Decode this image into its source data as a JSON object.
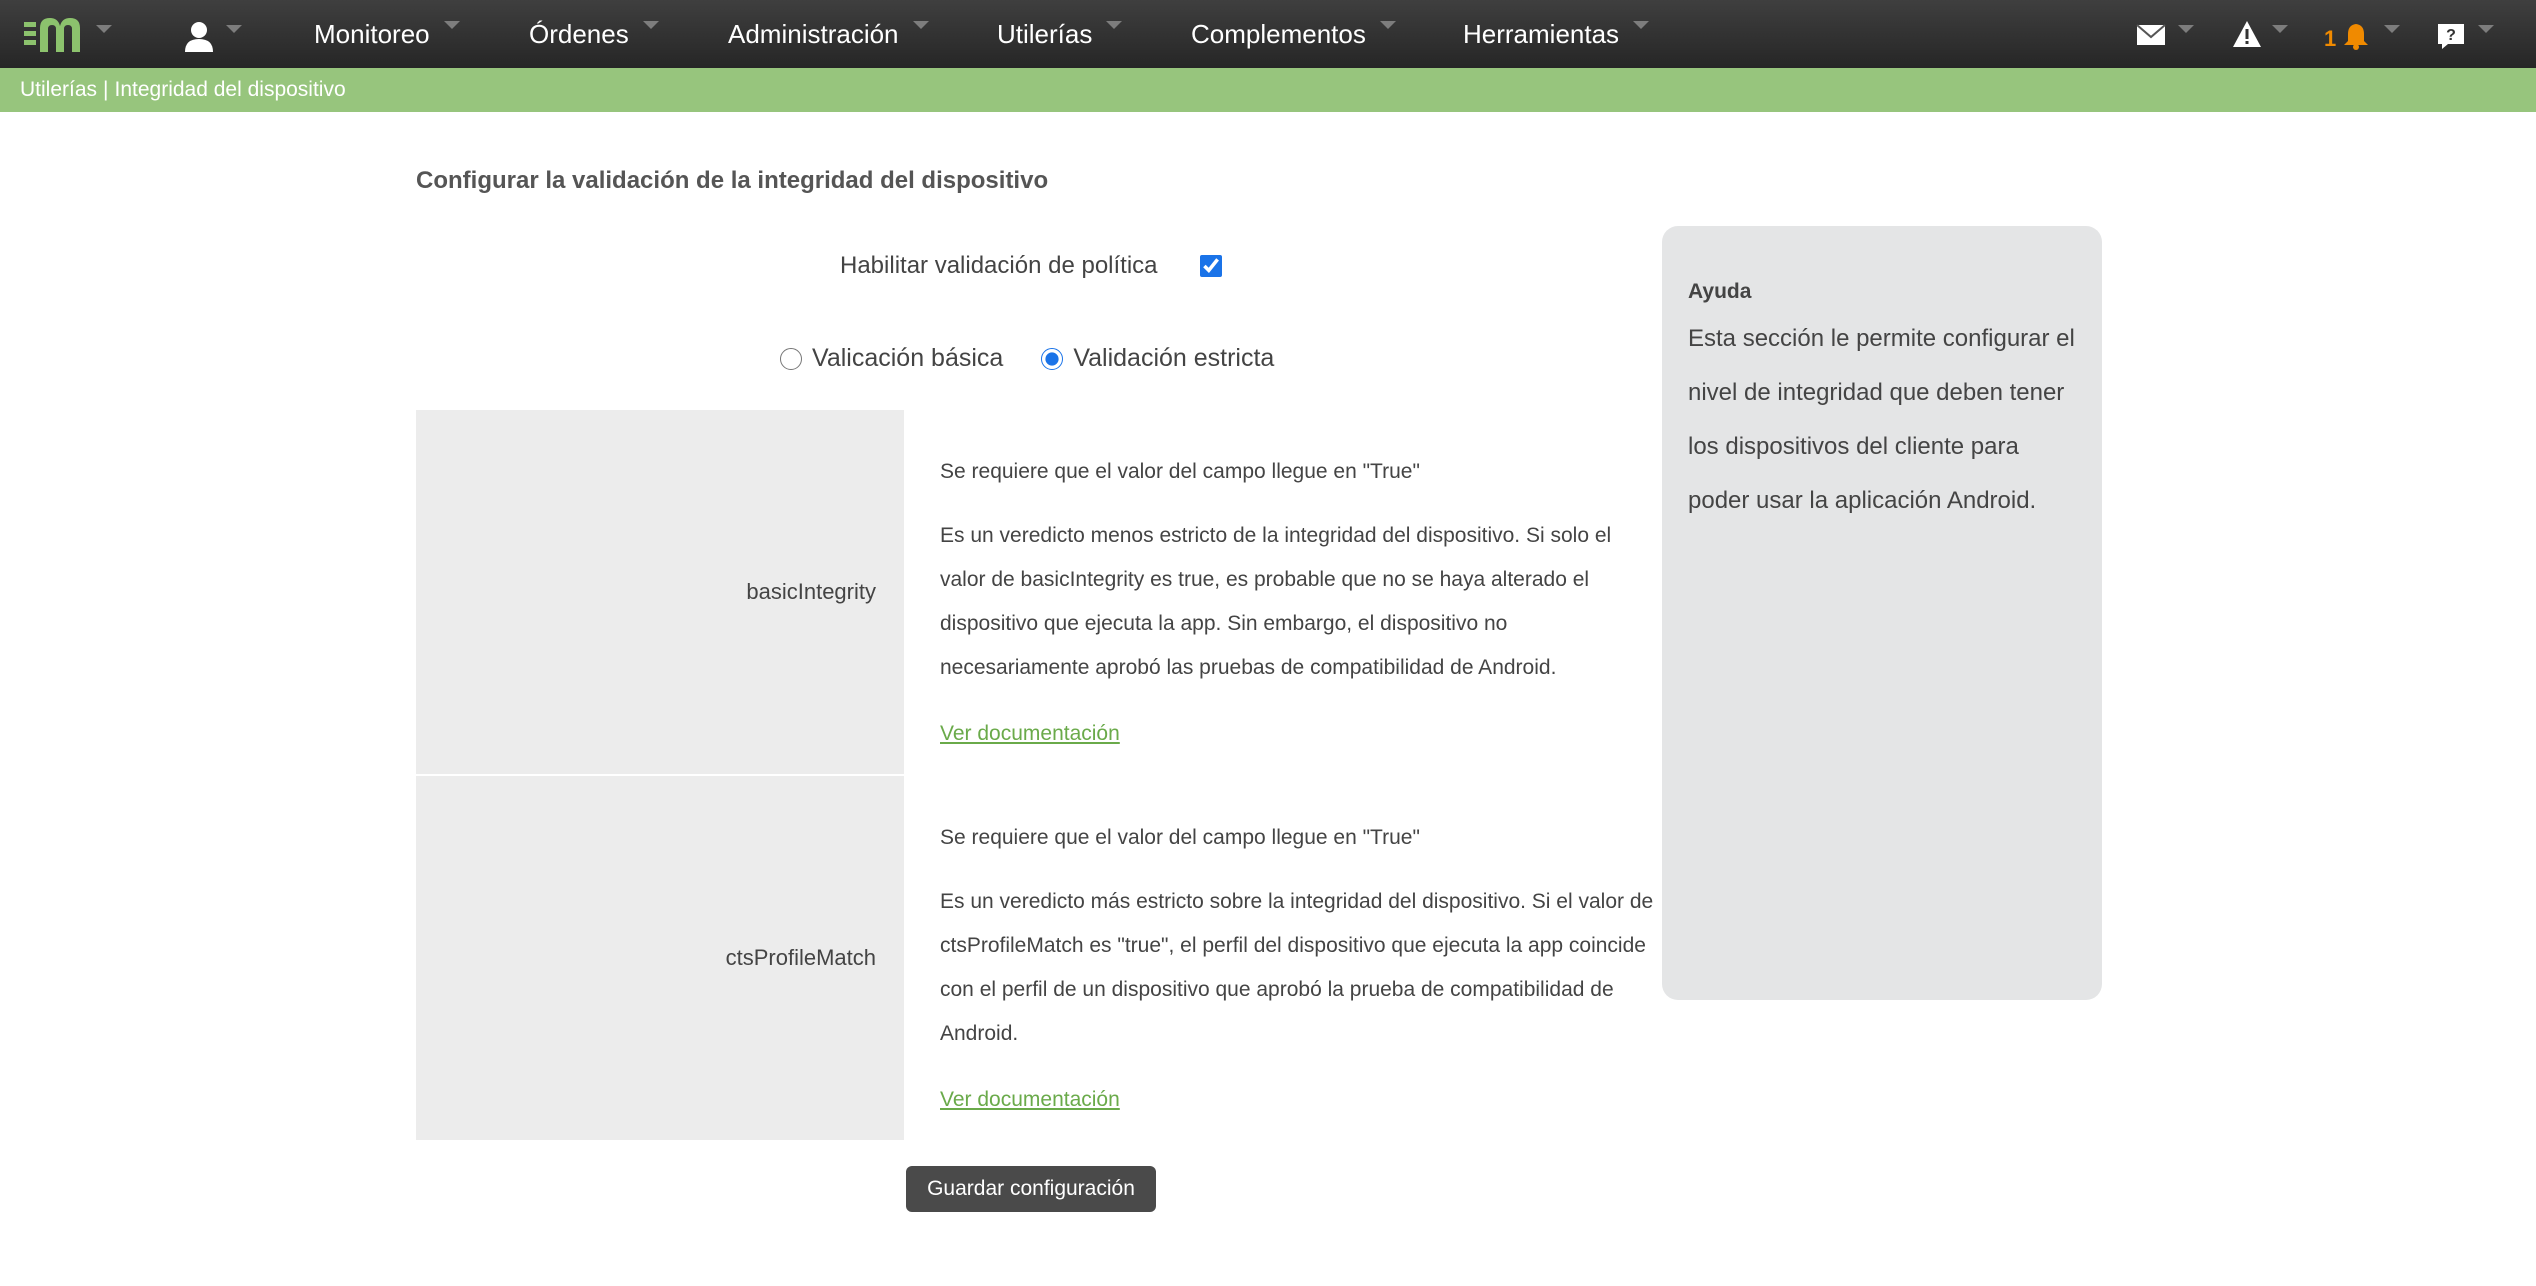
{
  "nav": {
    "items": [
      {
        "label": "Monitoreo"
      },
      {
        "label": "Órdenes"
      },
      {
        "label": "Administración"
      },
      {
        "label": "Utilerías"
      },
      {
        "label": "Complementos"
      },
      {
        "label": "Herramientas"
      }
    ],
    "notifications_count": "1",
    "icons": [
      "logo-m",
      "user-icon",
      "mail-icon",
      "warning-icon",
      "bell-icon",
      "help-icon"
    ],
    "brand_color": "#8cc26d",
    "notification_color": "#f08a00"
  },
  "breadcrumb": {
    "section": "Utilerías",
    "separator": "|",
    "page": "Integridad del dispositivo",
    "background": "#97c57d"
  },
  "main": {
    "title": "Configurar la validación de la integridad del dispositivo",
    "policy_label": "Habilitar validación de política",
    "policy_enabled": true,
    "validation_options": [
      {
        "label": "Valicación básica",
        "selected": false
      },
      {
        "label": "Validación estricta",
        "selected": true
      }
    ],
    "rules": [
      {
        "name": "basicIntegrity",
        "requirement": "Se requiere que el valor del campo llegue en \"True\"",
        "description": "Es un veredicto menos estricto de la integridad del dispositivo. Si solo el valor de basicIntegrity es true, es probable que no se haya alterado el dispositivo que ejecuta la app. Sin embargo, el dispositivo no necesariamente aprobó las pruebas de compatibilidad de Android.",
        "doc_link": "Ver documentación"
      },
      {
        "name": "ctsProfileMatch",
        "requirement": "Se requiere que el valor del campo llegue en \"True\"",
        "description": "Es un veredicto más estricto sobre la integridad del dispositivo. Si el valor de ctsProfileMatch es \"true\", el perfil del dispositivo que ejecuta la app coincide con el perfil de un dispositivo que aprobó la prueba de compatibilidad de Android.",
        "doc_link": "Ver documentación"
      }
    ],
    "save_label": "Guardar configuración"
  },
  "help": {
    "title": "Ayuda",
    "text": "Esta sección le permite configurar el nivel de integridad que deben tener los dispositivos del cliente para poder usar la aplicación Android."
  }
}
